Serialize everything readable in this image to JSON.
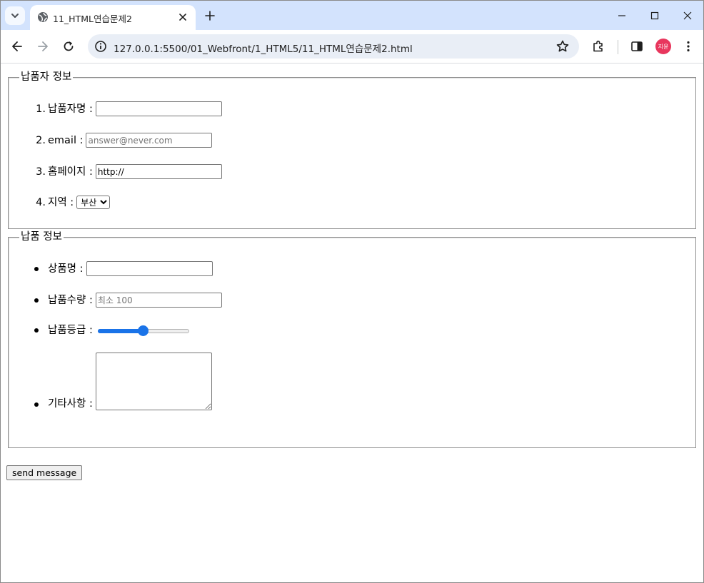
{
  "browser": {
    "tab_title": "11_HTML연습문제2",
    "url": "127.0.0.1:5500/01_Webfront/1_HTML5/11_HTML연습문제2.html",
    "profile_initials": "지윤",
    "profile_color": "#e8365d"
  },
  "supplier": {
    "legend": "납품자 정보",
    "fields": [
      {
        "marker": "1.",
        "label": "납품자명 :",
        "value": "",
        "placeholder": ""
      },
      {
        "marker": "2.",
        "label": "email :",
        "value": "",
        "placeholder": "answer@never.com"
      },
      {
        "marker": "3.",
        "label": "홈페이지 :",
        "value": "http://",
        "placeholder": ""
      },
      {
        "marker": "4.",
        "label": "지역 :",
        "selected": "부산"
      }
    ]
  },
  "delivery": {
    "legend": "납품 정보",
    "fields": [
      {
        "label": "상품명 :",
        "value": "",
        "placeholder": ""
      },
      {
        "label": "납품수량 :",
        "value": "",
        "placeholder": "최소 100"
      },
      {
        "label": "납품등급 :",
        "slider_fraction": 0.5
      },
      {
        "label": "기타사항 :",
        "value": ""
      }
    ]
  },
  "submit_label": "send message",
  "accent_color": "#1a73e8"
}
